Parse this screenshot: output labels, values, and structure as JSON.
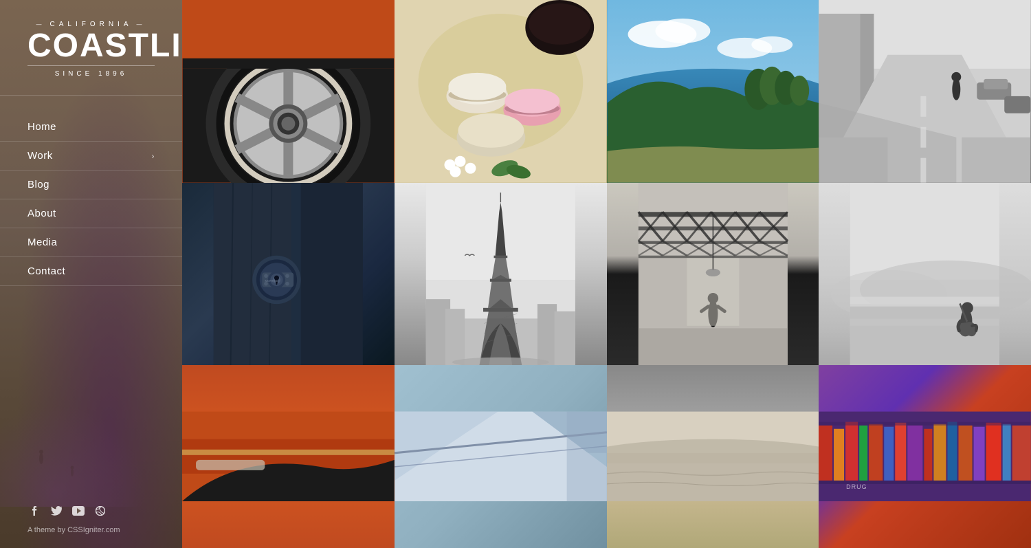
{
  "sidebar": {
    "logo": {
      "california": "CALIFORNIA",
      "coastline": "COASTLINE",
      "since": "SINCE 1896"
    },
    "nav": {
      "items": [
        {
          "label": "Home",
          "hasArrow": false
        },
        {
          "label": "Work",
          "hasArrow": true
        },
        {
          "label": "Blog",
          "hasArrow": false
        },
        {
          "label": "About",
          "hasArrow": false
        },
        {
          "label": "Media",
          "hasArrow": false
        },
        {
          "label": "Contact",
          "hasArrow": false
        }
      ]
    },
    "social": {
      "facebook": "f",
      "twitter": "t",
      "youtube": "▶",
      "dribbble": "◉"
    },
    "attribution": "A theme by CSSIgniter.com"
  },
  "grid": {
    "cells": [
      {
        "id": "car-wheel",
        "type": "car-wheel"
      },
      {
        "id": "macarons",
        "type": "macarons"
      },
      {
        "id": "coastline",
        "type": "coast"
      },
      {
        "id": "city-street",
        "type": "city"
      },
      {
        "id": "door-bolt",
        "type": "door"
      },
      {
        "id": "eiffel-tower",
        "type": "eiffel"
      },
      {
        "id": "industrial",
        "type": "industrial"
      },
      {
        "id": "misty-landscape",
        "type": "misty"
      },
      {
        "id": "orange-partial",
        "type": "orange-partial"
      },
      {
        "id": "abstract-lines",
        "type": "abstract"
      },
      {
        "id": "beach2",
        "type": "beach2"
      },
      {
        "id": "bookshelf",
        "type": "bookshelf"
      }
    ]
  }
}
